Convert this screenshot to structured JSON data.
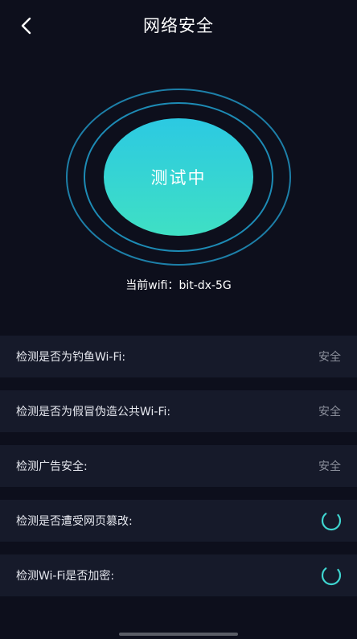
{
  "header": {
    "title": "网络安全",
    "back_icon": "chevron-left-icon"
  },
  "scanner": {
    "status_text": "测试中"
  },
  "wifi": {
    "label": "当前wifi：",
    "ssid": "bit-dx-5G"
  },
  "checks": [
    {
      "label": "检测是否为钓鱼Wi-Fi:",
      "status": "安全"
    },
    {
      "label": "检测是否为假冒伪造公共Wi-Fi:",
      "status": "安全"
    },
    {
      "label": "检测广告安全:",
      "status": "安全"
    },
    {
      "label": "检测是否遭受网页篡改:",
      "status": "",
      "state_icon": "loading-spinner-icon"
    },
    {
      "label": "检测Wi-Fi是否加密:",
      "status": "",
      "state_icon": "loading-spinner-icon"
    }
  ],
  "colors": {
    "background": "#0d0f1c",
    "row_background": "#161a2a",
    "ring": "#1d8bb5",
    "core_gradient_top": "#2cc9e2",
    "core_gradient_bottom": "#3fe0c4",
    "spinner": "#3fd6d0"
  }
}
